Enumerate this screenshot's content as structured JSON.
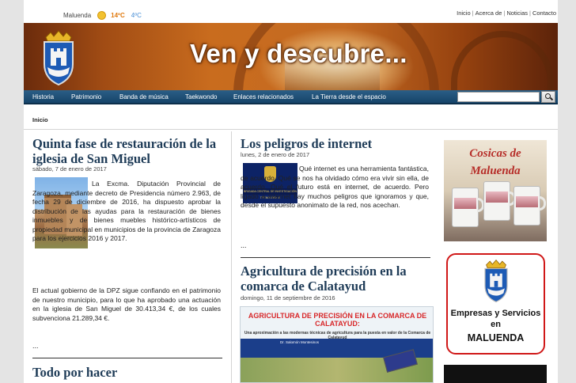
{
  "weather": {
    "location": "Maluenda",
    "high": "14ºC",
    "low": "4ºC"
  },
  "toplinks": [
    {
      "label": "Inicio"
    },
    {
      "label": "Acerca de"
    },
    {
      "label": "Noticias"
    },
    {
      "label": "Contacto"
    }
  ],
  "banner": {
    "title": "Ven y descubre..."
  },
  "nav": {
    "items": [
      {
        "label": "Historia"
      },
      {
        "label": "Patrimonio"
      },
      {
        "label": "Banda de música"
      },
      {
        "label": "Taekwondo"
      },
      {
        "label": "Enlaces relacionados"
      },
      {
        "label": "La Tierra desde el espacio"
      }
    ],
    "search_placeholder": ""
  },
  "breadcrumb": "Inicio",
  "articles": {
    "a1": {
      "title": "Quinta fase de restauración de la iglesia de San Miguel",
      "date": "sábado, 7 de enero de 2017",
      "p1": "La Excma. Diputación Provincial de Zaragoza, mediante decreto de Presidencia número 2.963, de fecha 29 de diciembre de 2016, ha dispuesto aprobar la distribución de las ayudas para la restauración de bienes inmuebles y de bienes muebles histórico-artísticos de propiedad municipal en municipios de la provincia de Zaragoza para los ejercicios 2016 y 2017.",
      "p2": "El actual gobierno de la DPZ sigue confiando en el patrimonio de nuestro municipio, para lo que ha aprobado una actuación en la iglesia de San Miguel de 30.413,34 €, de los cuales subvenciona 21.289,34 €.",
      "more": "..."
    },
    "a2": {
      "title": "Todo por hacer"
    },
    "a3": {
      "title": "Los peligros de internet",
      "date": "lunes, 2 de enero de 2017",
      "text": "Qué internet es una herramienta fantástica, de acuerdo. Qué se nos ha olvidado cómo era vivir sin ella, de acuerdo. Qué el futuro está en internet, de acuerdo. Pero ligado a internet hay muchos peligros que ignoramos y que, desde el supuesto anonimato de la red, nos acechan.",
      "more": "...",
      "image_caption": "BRIGADA CENTRAL DE INVESTIGACIÓN TECNOLÓGICA"
    },
    "a4": {
      "title": "Agricultura de precisión en la comarca de Calatayud",
      "date": "domingo, 11 de septiembre de 2016",
      "poster_title": "AGRICULTURA DE PRECISIÓN EN LA COMARCA DE CALATAYUD:",
      "poster_sub": "Una aproximación a las modernas técnicas de agricultura para la puesta en valor de la Comarca de Calatayud",
      "poster_credit": "Dr. Salomón Montesinos"
    }
  },
  "sidebar": {
    "cosicas_title": "Cosicas de Maluenda",
    "empresas_line1": "Empresas y Servicios",
    "empresas_line2": "en",
    "empresas_line3": "MALUENDA"
  },
  "colors": {
    "nav_bg": "#164469",
    "title_blue": "#1e3b57",
    "accent_red": "#d01818"
  }
}
